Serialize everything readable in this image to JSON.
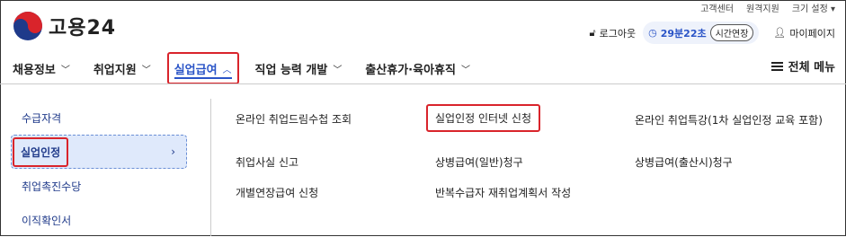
{
  "util_links": [
    "고객센터",
    "원격지원",
    "크기 설정"
  ],
  "brand": {
    "name": "고용24"
  },
  "header": {
    "logout": "로그아웃",
    "timer": "29분22초",
    "extend": "시간연장",
    "mypage": "마이페이지"
  },
  "nav": [
    {
      "label": "채용정보"
    },
    {
      "label": "취업지원"
    },
    {
      "label": "실업급여"
    },
    {
      "label": "직업 능력 개발"
    },
    {
      "label": "출산휴가·육아휴직"
    }
  ],
  "all_menu": "전체 메뉴",
  "sidebar": [
    {
      "label": "수급자격"
    },
    {
      "label": "실업인정"
    },
    {
      "label": "취업촉진수당"
    },
    {
      "label": "이직확인서"
    }
  ],
  "submenu": [
    [
      "온라인 취업드림수첩 조회",
      "실업인정 인터넷 신청",
      "온라인 취업특강(1차 실업인정 교육 포함)"
    ],
    [
      "취업사실 신고",
      "상병급여(일반)청구",
      "상병급여(출산시)청구"
    ],
    [
      "개별연장급여 신청",
      "반복수급자 재취업계획서 작성"
    ]
  ]
}
